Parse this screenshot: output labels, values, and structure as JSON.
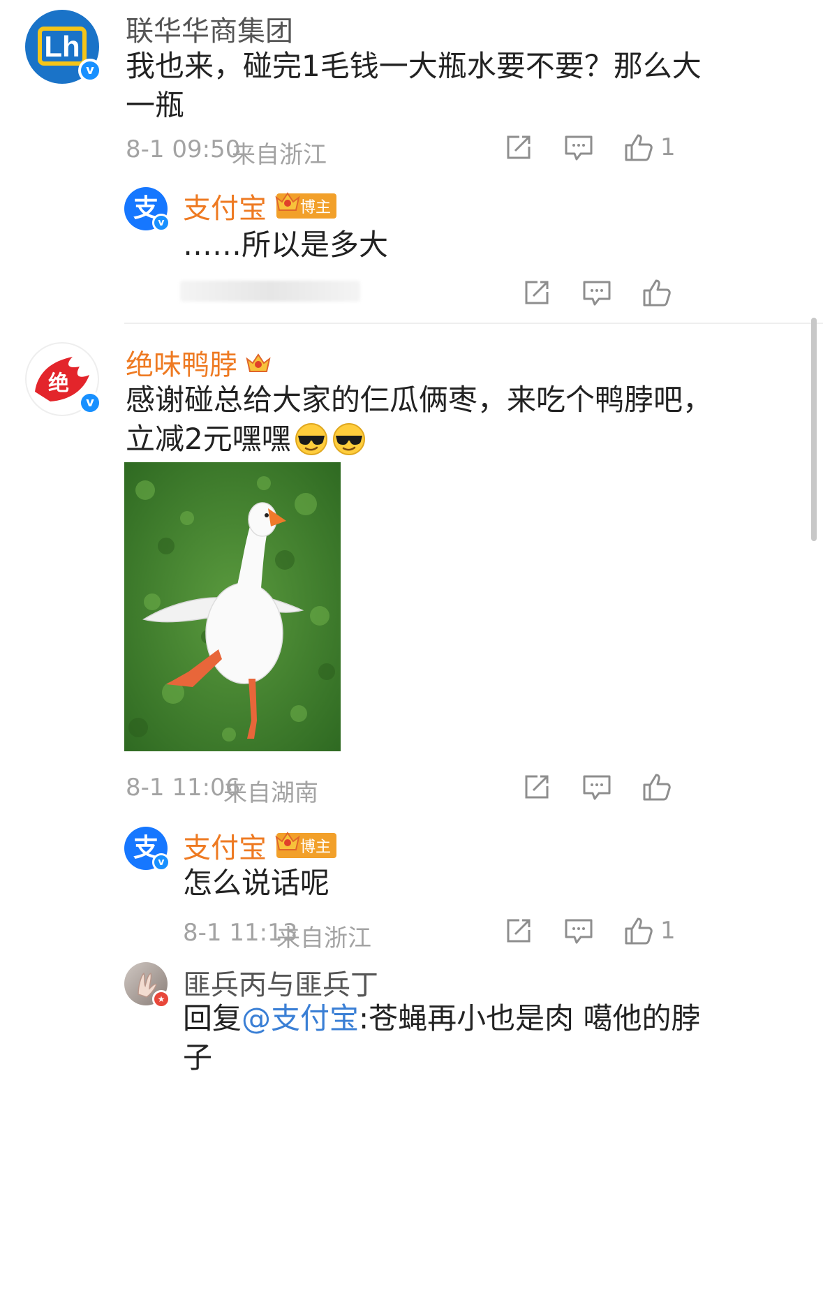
{
  "comments": [
    {
      "user": "联华华商集团",
      "text": "我也来，碰完1毛钱一大瓶水要不要？那么大一瓶",
      "text_line1": "我也来，碰完1毛钱一大瓶水要不要？那么大",
      "text_line2": "一瓶",
      "time": "8-1 09:50",
      "location": "来自浙江",
      "likes": "1",
      "replies": [
        {
          "user": "支付宝",
          "badge": "博主",
          "text": "……所以是多大"
        }
      ]
    },
    {
      "user": "绝味鸭脖",
      "text_line1": "感谢碰总给大家的仨瓜俩枣，来吃个鸭脖吧，",
      "text_line2": "立减2元嘿嘿",
      "emoji": "cool-sunglasses-emoji",
      "time": "8-1 11:06",
      "location": "来自湖南",
      "replies": [
        {
          "user": "支付宝",
          "badge": "博主",
          "text": "怎么说话呢",
          "time": "8-1 11:13",
          "location": "来自浙江",
          "likes": "1"
        },
        {
          "user": "匪兵丙与匪兵丁",
          "reply_prefix": "回复",
          "mention": "@支付宝",
          "text_after": ":苍蝇再小也是肉 噶他的脖",
          "text_line2": "子"
        }
      ]
    }
  ],
  "icons": {
    "share": "share-icon",
    "comment": "comment-icon",
    "like": "thumbs-up-icon",
    "verified": "verified-v-icon",
    "crown": "crown-icon"
  },
  "colors": {
    "orange_name": "#ee7a22",
    "mention_blue": "#3a7fd5",
    "verified_blue": "#1890ff",
    "badge_orange": "#f2a02a"
  }
}
